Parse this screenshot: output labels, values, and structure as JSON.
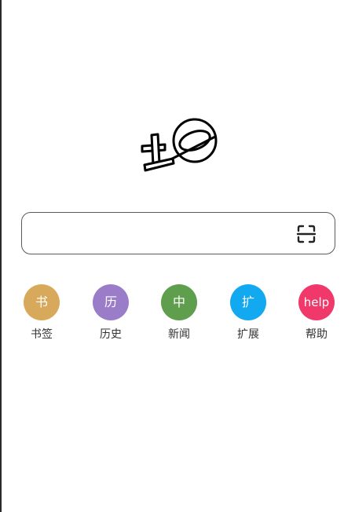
{
  "shortcuts": [
    {
      "id": "bookmarks",
      "icon_text": "书",
      "label": "书签",
      "color": "#D9A95B"
    },
    {
      "id": "history",
      "icon_text": "历",
      "label": "历史",
      "color": "#9B7CC8"
    },
    {
      "id": "news",
      "icon_text": "中",
      "label": "新闻",
      "color": "#5E9E4D"
    },
    {
      "id": "extensions",
      "icon_text": "扩",
      "label": "扩展",
      "color": "#12A9F0"
    },
    {
      "id": "help",
      "icon_text": "help",
      "label": "帮助",
      "color": "#F0386B"
    }
  ],
  "icons": {
    "logo": "browser-logo-icon",
    "scan": "scan-icon"
  }
}
